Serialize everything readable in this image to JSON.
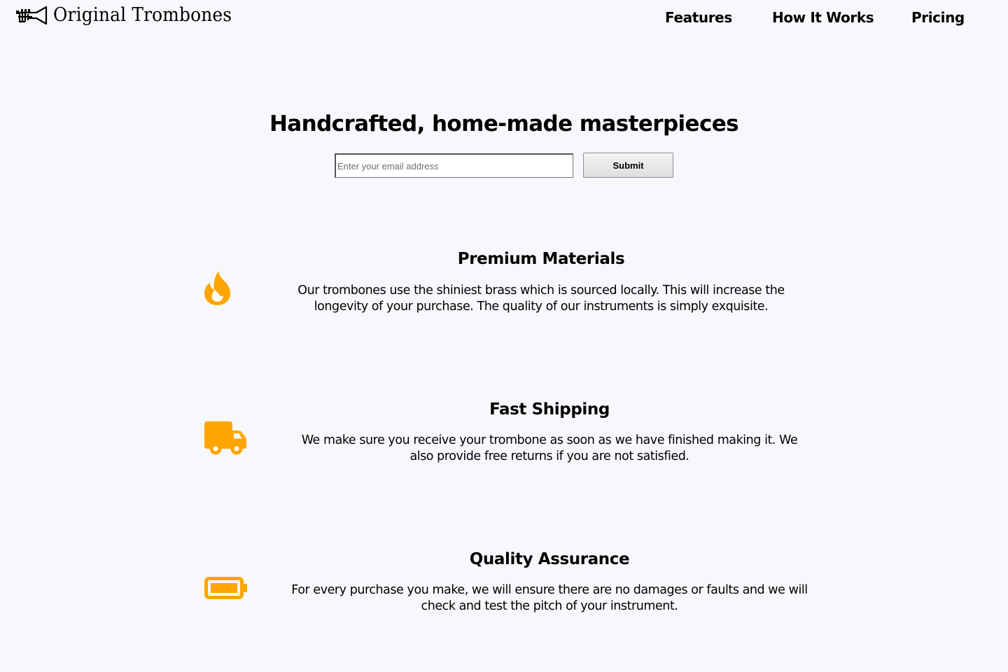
{
  "brand": {
    "name": "Original Trombones",
    "logo_icon": "trombone-icon"
  },
  "nav": {
    "features": "Features",
    "how_it_works": "How It Works",
    "pricing": "Pricing"
  },
  "hero": {
    "title": "Handcrafted, home-made masterpieces",
    "email_placeholder": "Enter your email address",
    "submit_label": "Submit"
  },
  "features": [
    {
      "icon": "fire-icon",
      "title": "Premium Materials",
      "description": "Our trombones use the shiniest brass which is sourced locally. This will increase the longevity of your purchase. The quality of our instruments is simply exquisite."
    },
    {
      "icon": "truck-icon",
      "title": "Fast Shipping",
      "description": "We make sure you receive your trombone as soon as we have finished making it. We also provide free returns if you are not satisfied."
    },
    {
      "icon": "battery-icon",
      "title": "Quality Assurance",
      "description": "For every purchase you make, we will ensure there are no damages or faults and we will check and test the pitch of your instrument."
    }
  ],
  "colors": {
    "accent": "#ffa500",
    "background": "#f7f8fc",
    "text": "#000000"
  }
}
